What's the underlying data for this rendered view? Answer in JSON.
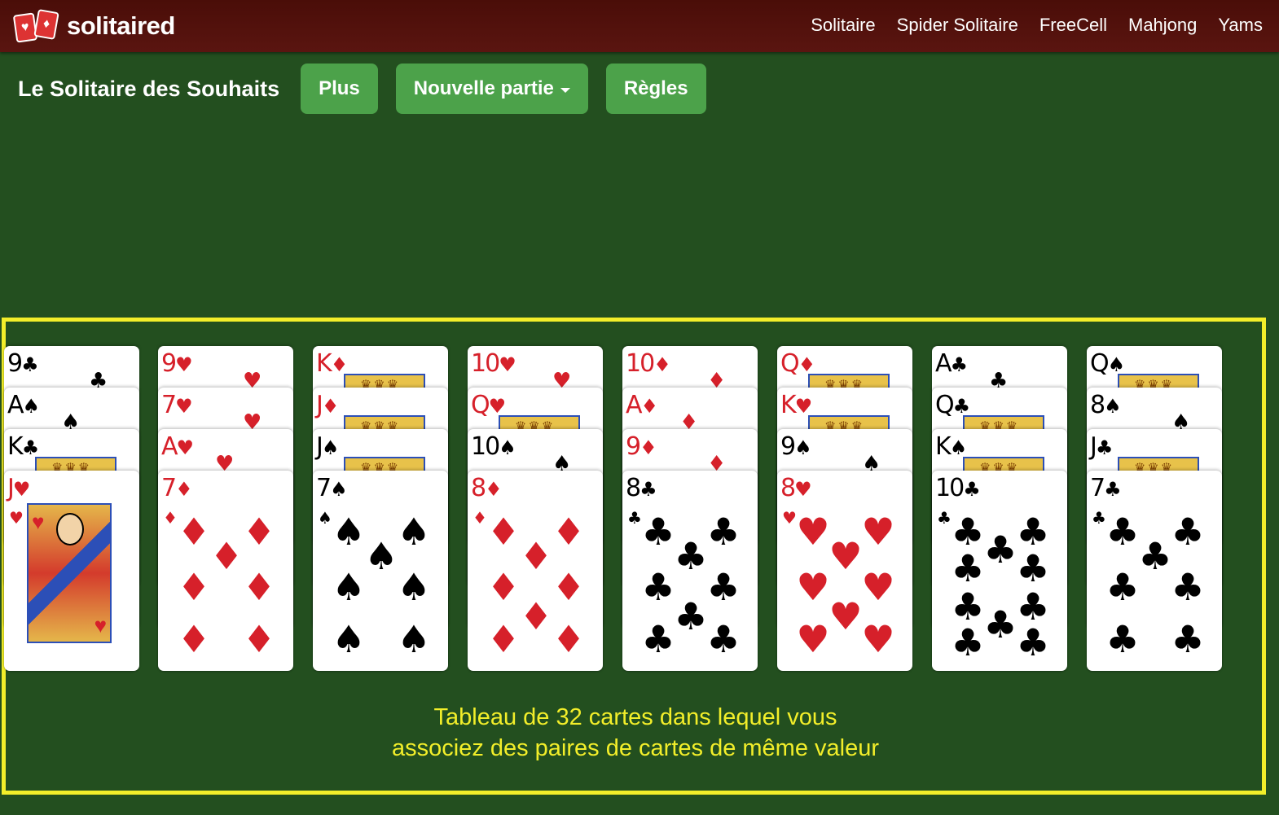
{
  "header": {
    "logo_text": "solitaired",
    "logo_suits": [
      "♥",
      "♦"
    ],
    "nav": [
      "Solitaire",
      "Spider Solitaire",
      "FreeCell",
      "Mahjong",
      "Yams"
    ]
  },
  "toolbar": {
    "title": "Le Solitaire des Souhaits",
    "plus_label": "Plus",
    "new_game_label": "Nouvelle partie",
    "rules_label": "Règles"
  },
  "tableau": {
    "columns": [
      [
        {
          "rank": "9",
          "suit": "♣"
        },
        {
          "rank": "A",
          "suit": "♠"
        },
        {
          "rank": "K",
          "suit": "♣"
        },
        {
          "rank": "J",
          "suit": "♥"
        }
      ],
      [
        {
          "rank": "9",
          "suit": "♥"
        },
        {
          "rank": "7",
          "suit": "♥"
        },
        {
          "rank": "A",
          "suit": "♥"
        },
        {
          "rank": "7",
          "suit": "♦"
        }
      ],
      [
        {
          "rank": "K",
          "suit": "♦"
        },
        {
          "rank": "J",
          "suit": "♦"
        },
        {
          "rank": "J",
          "suit": "♠"
        },
        {
          "rank": "7",
          "suit": "♠"
        }
      ],
      [
        {
          "rank": "10",
          "suit": "♥"
        },
        {
          "rank": "Q",
          "suit": "♥"
        },
        {
          "rank": "10",
          "suit": "♠"
        },
        {
          "rank": "8",
          "suit": "♦"
        }
      ],
      [
        {
          "rank": "10",
          "suit": "♦"
        },
        {
          "rank": "A",
          "suit": "♦"
        },
        {
          "rank": "9",
          "suit": "♦"
        },
        {
          "rank": "8",
          "suit": "♣"
        }
      ],
      [
        {
          "rank": "Q",
          "suit": "♦"
        },
        {
          "rank": "K",
          "suit": "♥"
        },
        {
          "rank": "9",
          "suit": "♠"
        },
        {
          "rank": "8",
          "suit": "♥"
        }
      ],
      [
        {
          "rank": "A",
          "suit": "♣"
        },
        {
          "rank": "Q",
          "suit": "♣"
        },
        {
          "rank": "K",
          "suit": "♠"
        },
        {
          "rank": "10",
          "suit": "♣"
        }
      ],
      [
        {
          "rank": "Q",
          "suit": "♠"
        },
        {
          "rank": "8",
          "suit": "♠"
        },
        {
          "rank": "J",
          "suit": "♣"
        },
        {
          "rank": "7",
          "suit": "♣"
        }
      ]
    ]
  },
  "caption": {
    "line1": "Tableau de 32 cartes dans lequel vous",
    "line2": "associez des paires de cartes de même valeur"
  },
  "colors": {
    "felt": "#234f1f",
    "header": "#4a0d08",
    "button": "#4ca24a",
    "highlight": "#f2ee2a",
    "red_suit": "#d6202a",
    "black_suit": "#000000"
  }
}
